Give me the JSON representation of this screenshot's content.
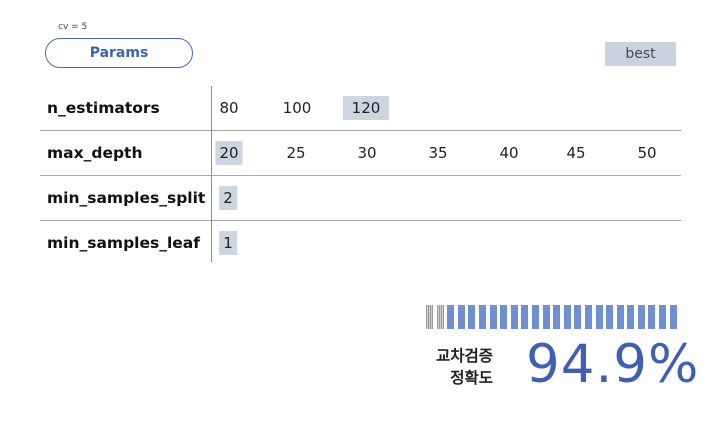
{
  "header": {
    "cv_note": "cv = 5",
    "params_label": "Params",
    "best_label": "best"
  },
  "params": [
    {
      "name": "n_estimators",
      "values": [
        "80",
        "100",
        "120"
      ],
      "best_index": 2
    },
    {
      "name": "max_depth",
      "values": [
        "20",
        "25",
        "30",
        "35",
        "40",
        "45",
        "50"
      ],
      "best_index": 0
    },
    {
      "name": "min_samples_split",
      "values": [
        "2"
      ],
      "best_index": 0
    },
    {
      "name": "min_samples_leaf",
      "values": [
        "1"
      ],
      "best_index": 0
    }
  ],
  "result": {
    "label_line1": "교차검증",
    "label_line2": "정확도",
    "accuracy_text": "94.9%",
    "accuracy_fraction": 0.949,
    "gauge_segments": 24,
    "accent_color": "#3f5fb5",
    "highlight_color": "#cdd5e0"
  }
}
